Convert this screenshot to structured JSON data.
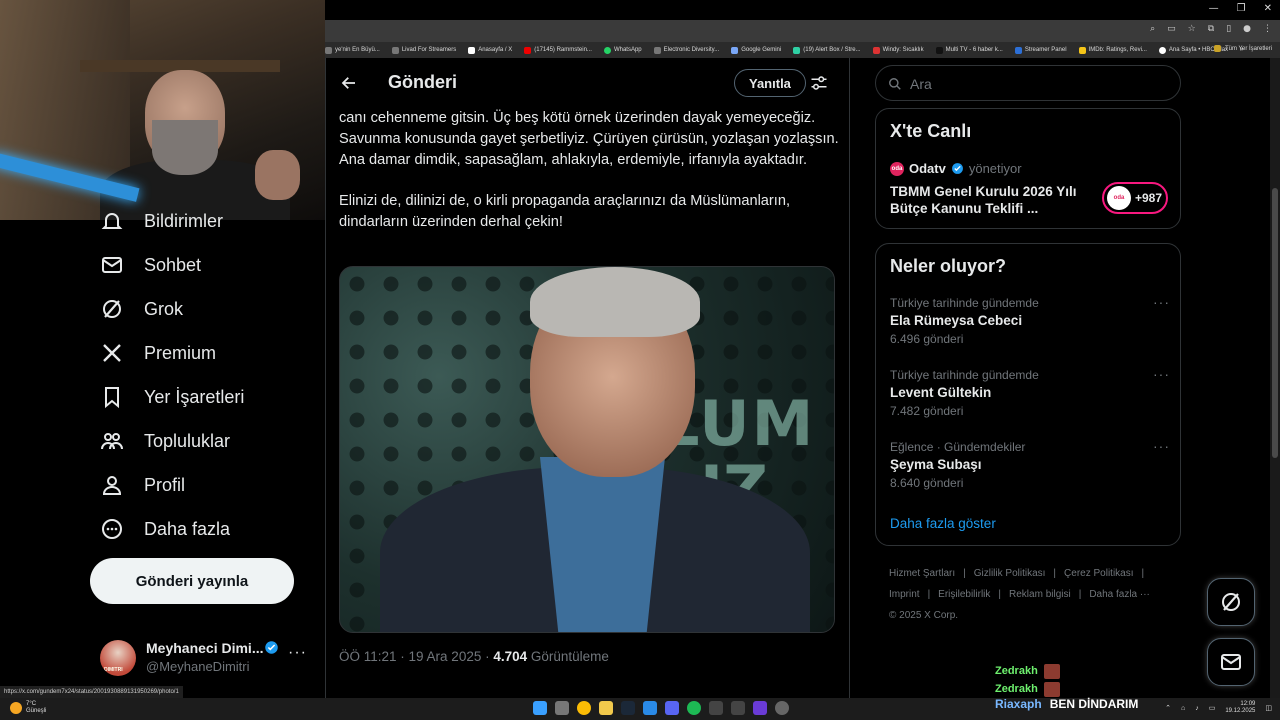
{
  "browser": {
    "bookmarks": [
      "ye'nin En Büyü...",
      "Livad For Streamers",
      "Anasayfa / X",
      "(17145) Rammstein...",
      "WhatsApp",
      "Electronic Diversity...",
      "Google Gemini",
      "(19) Alert Box / Stre...",
      "Windy: Sıcaklık",
      "Multi TV - 6 haber k...",
      "Streamer Panel",
      "IMDb: Ratings, Revi...",
      "Ana Sayfa • HBO Max"
    ],
    "bookmarks_all": "Tüm Yer İşaretleri",
    "bookmarks_overflow": "»"
  },
  "sidebar": {
    "partial_item": "Bildirimler",
    "items": [
      {
        "label": "Sohbet",
        "icon": "mail-icon"
      },
      {
        "label": "Grok",
        "icon": "grok-icon"
      },
      {
        "label": "Premium",
        "icon": "x-logo-icon"
      },
      {
        "label": "Yer İşaretleri",
        "icon": "bookmark-icon"
      },
      {
        "label": "Topluluklar",
        "icon": "communities-icon"
      },
      {
        "label": "Profil",
        "icon": "profile-icon"
      },
      {
        "label": "Daha fazla",
        "icon": "more-circle-icon"
      }
    ],
    "post_button": "Gönderi yayınla",
    "account": {
      "name": "Meyhaneci Dimi...",
      "handle": "@MeyhaneDimitri",
      "avatar_text": "DIMITRI",
      "more": "···"
    }
  },
  "main": {
    "title": "Gönderi",
    "reply_button": "Yanıtla",
    "tweet_paragraphs": [
      "canı cehenneme gitsin. Üç beş kötü örnek üzerinden dayak yemeyeceğiz. Savunma konusunda gayet şerbetliyiz. Çürüyen çürüsün, yozlaşan yozlaşsın. Ana damar dimdik, sapasağlam, ahlakıyla, erdemiyle, irfanıyla ayaktadır.",
      "Elinizi de, dilinizi de, o kirli propaganda araçlarınızı da Müslümanların, dindarların üzerinden derhal çekin!"
    ],
    "photo_sign_top": "LUM",
    "photo_sign_bottom": "IZ",
    "meta": {
      "time": "ÖÖ 11:21 · 19 Ara 2025 · ",
      "views_count": "4.704",
      "views_label": " Görüntüleme"
    }
  },
  "right": {
    "search_placeholder": "Ara",
    "live": {
      "title": "X'te Canlı",
      "host": "Odatv",
      "host_role": "yönetiyor",
      "host_icon_text": "oda",
      "stream_title": "TBMM Genel Kurulu 2026 Yılı Bütçe Kanunu Teklifi ...",
      "viewer_count": "+987"
    },
    "trends": {
      "title": "Neler oluyor?",
      "items": [
        {
          "context": "Türkiye tarihinde gündemde",
          "name": "Ela Rümeysa Cebeci",
          "count": "6.496 gönderi"
        },
        {
          "context": "Türkiye tarihinde gündemde",
          "name": "Levent Gültekin",
          "count": "7.482 gönderi"
        },
        {
          "context": "Eğlence · Gündemdekiler",
          "name": "Şeyma Subaşı",
          "count": "8.640 gönderi"
        }
      ],
      "more_glyph": "···",
      "show_more": "Daha fazla göster"
    },
    "footer": [
      "Hizmet Şartları",
      "|",
      "Gizlilik Politikası",
      "|",
      "Çerez Politikası",
      "|",
      "Imprint",
      "|",
      "Erişilebilirlik",
      "|",
      "Reklam bilgisi",
      "|",
      "Daha fazla ···",
      "© 2025 X Corp."
    ]
  },
  "chat": {
    "lines": [
      {
        "user": "Zedrakh"
      },
      {
        "user": "Zedrakh"
      }
    ],
    "last": {
      "user": "Riaxaph",
      "message": "BEN DİNDARIM"
    }
  },
  "status_url": "https://x.com/gundem7x24/status/2001930889131950269/photo/1",
  "taskbar": {
    "weather_temp": "7°C",
    "weather_desc": "Güneşli",
    "time": "12:09",
    "date": "19.12.2025"
  },
  "colors": {
    "accent": "#1d9bf0",
    "live_pink": "#f91880",
    "text_primary": "#e7e9ea",
    "text_secondary": "#71767b",
    "border": "#2f3336"
  }
}
